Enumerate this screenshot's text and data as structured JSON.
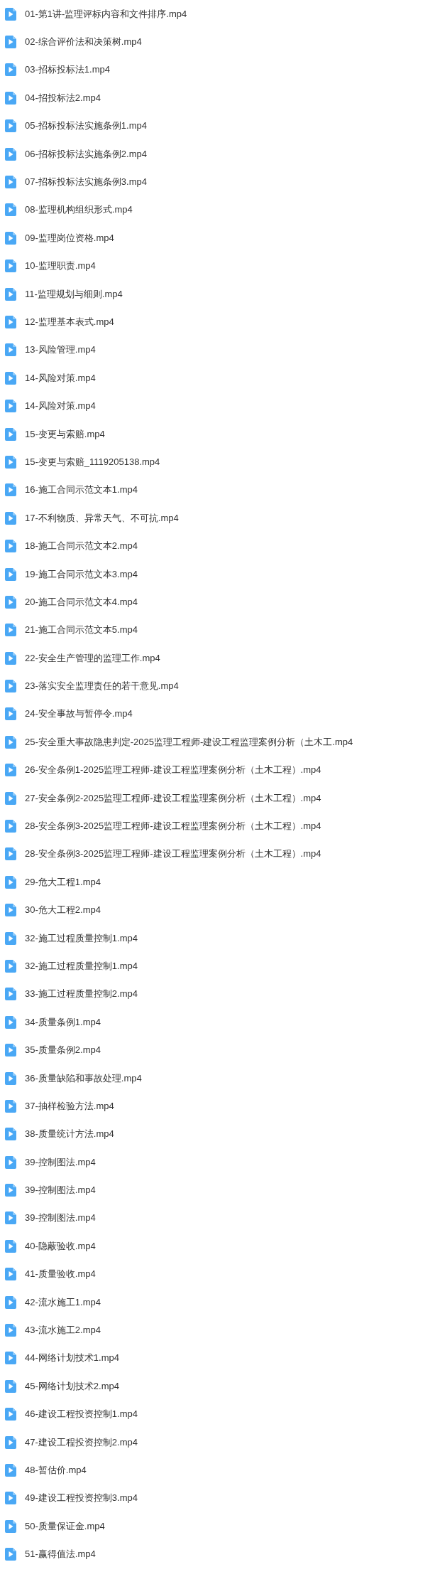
{
  "files": [
    {
      "name": "01-第1讲-监理评标内容和文件排序.mp4"
    },
    {
      "name": "02-综合评价法和决策树.mp4"
    },
    {
      "name": "03-招标投标法1.mp4"
    },
    {
      "name": "04-招投标法2.mp4"
    },
    {
      "name": "05-招标投标法实施条例1.mp4"
    },
    {
      "name": "06-招标投标法实施条例2.mp4"
    },
    {
      "name": "07-招标投标法实施条例3.mp4"
    },
    {
      "name": "08-监理机构组织形式.mp4"
    },
    {
      "name": "09-监理岗位资格.mp4"
    },
    {
      "name": "10-监理职责.mp4"
    },
    {
      "name": "11-监理规划与细则.mp4"
    },
    {
      "name": "12-监理基本表式.mp4"
    },
    {
      "name": "13-风险管理.mp4"
    },
    {
      "name": "14-风险对策.mp4"
    },
    {
      "name": "14-风险对策.mp4"
    },
    {
      "name": "15-变更与索赔.mp4"
    },
    {
      "name": "15-变更与索赔_1119205138.mp4"
    },
    {
      "name": "16-施工合同示范文本1.mp4"
    },
    {
      "name": "17-不利物质、异常天气、不可抗.mp4"
    },
    {
      "name": "18-施工合同示范文本2.mp4"
    },
    {
      "name": "19-施工合同示范文本3.mp4"
    },
    {
      "name": "20-施工合同示范文本4.mp4"
    },
    {
      "name": "21-施工合同示范文本5.mp4"
    },
    {
      "name": "22-安全生产管理的监理工作.mp4"
    },
    {
      "name": "23-落实安全监理责任的若干意见.mp4"
    },
    {
      "name": "24-安全事故与暂停令.mp4"
    },
    {
      "name": "25-安全重大事故隐患判定-2025监理工程师-建设工程监理案例分析（土木工.mp4"
    },
    {
      "name": "26-安全条例1-2025监理工程师-建设工程监理案例分析（土木工程）.mp4"
    },
    {
      "name": "27-安全条例2-2025监理工程师-建设工程监理案例分析（土木工程）.mp4"
    },
    {
      "name": "28-安全条例3-2025监理工程师-建设工程监理案例分析（土木工程）.mp4"
    },
    {
      "name": "28-安全条例3-2025监理工程师-建设工程监理案例分析（土木工程）.mp4"
    },
    {
      "name": "29-危大工程1.mp4"
    },
    {
      "name": "30-危大工程2.mp4"
    },
    {
      "name": "32-施工过程质量控制1.mp4"
    },
    {
      "name": "32-施工过程质量控制1.mp4"
    },
    {
      "name": "33-施工过程质量控制2.mp4"
    },
    {
      "name": "34-质量条例1.mp4"
    },
    {
      "name": "35-质量条例2.mp4"
    },
    {
      "name": "36-质量缺陷和事故处理.mp4"
    },
    {
      "name": "37-抽样检验方法.mp4"
    },
    {
      "name": "38-质量统计方法.mp4"
    },
    {
      "name": "39-控制图法.mp4"
    },
    {
      "name": "39-控制图法.mp4"
    },
    {
      "name": "39-控制图法.mp4"
    },
    {
      "name": "40-隐蔽验收.mp4"
    },
    {
      "name": "41-质量验收.mp4"
    },
    {
      "name": "42-流水施工1.mp4"
    },
    {
      "name": "43-流水施工2.mp4"
    },
    {
      "name": "44-网络计划技术1.mp4"
    },
    {
      "name": "45-网络计划技术2.mp4"
    },
    {
      "name": "46-建设工程投资控制1.mp4"
    },
    {
      "name": "47-建设工程投资控制2.mp4"
    },
    {
      "name": "48-暂估价.mp4"
    },
    {
      "name": "49-建设工程投资控制3.mp4"
    },
    {
      "name": "50-质量保证金.mp4"
    },
    {
      "name": "51-赢得值法.mp4"
    }
  ]
}
